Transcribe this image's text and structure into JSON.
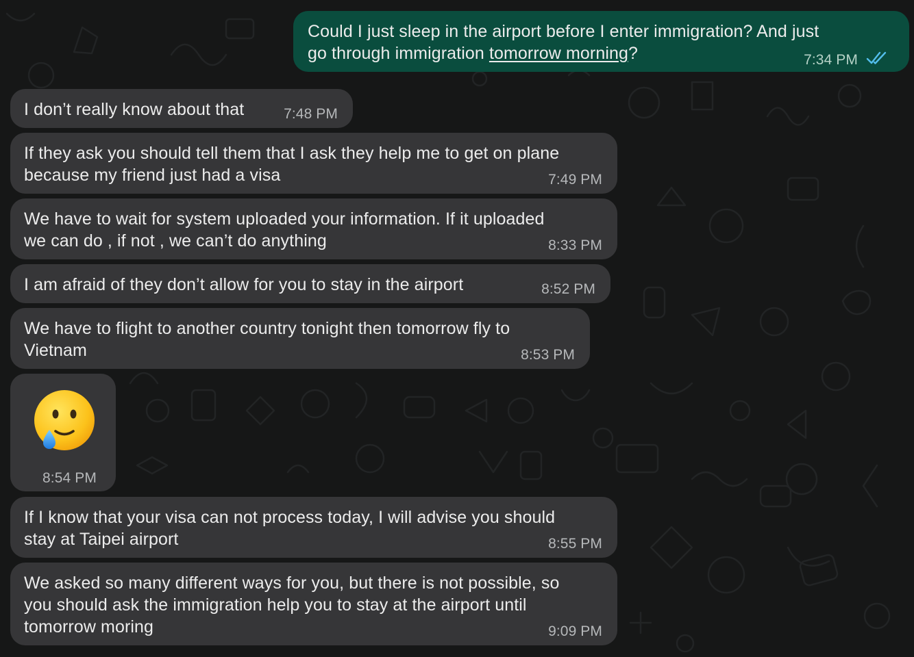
{
  "chat": {
    "outgoing": {
      "line1": "Could I just sleep in the airport before I enter immigration? And just",
      "line2_pre": "go through immigration ",
      "line2_link": "tomorrow morning",
      "line2_post": "?",
      "time": "7:34 PM",
      "status_icon": "double-check-read-icon"
    },
    "messages": [
      {
        "lines": [
          "I don’t really know about that"
        ],
        "time": "7:48 PM"
      },
      {
        "lines": [
          "If they ask you should tell them that I ask they help me to get on plane",
          "because my friend just had a visa"
        ],
        "time": "7:49 PM"
      },
      {
        "lines": [
          "We have to wait for system uploaded your information. If it uploaded",
          "we can do , if not , we can’t do anything"
        ],
        "time": "8:33 PM"
      },
      {
        "lines": [
          "I am afraid of they don’t allow for you to stay in the airport"
        ],
        "time": "8:52 PM"
      },
      {
        "lines": [
          "We have to flight to another country tonight then tomorrow fly to",
          "Vietnam"
        ],
        "time": "8:53 PM"
      },
      {
        "emoji": "smiling-face-with-tear-icon",
        "time": "8:54 PM"
      },
      {
        "lines": [
          "If I know that your visa can not process today, I will advise you should",
          "stay at Taipei airport"
        ],
        "time": "8:55 PM"
      },
      {
        "lines": [
          "We asked so many different ways for you, but there is not possible, so",
          "you should ask the immigration help you to stay at the airport until",
          "tomorrow moring"
        ],
        "time": "9:09 PM"
      }
    ]
  },
  "colors": {
    "background": "#161717",
    "incoming_bubble": "#363638",
    "outgoing_bubble": "#0a4d3e",
    "text": "#ececec",
    "timestamp": "#b6b8ba",
    "read_tick": "#53bdeb"
  }
}
